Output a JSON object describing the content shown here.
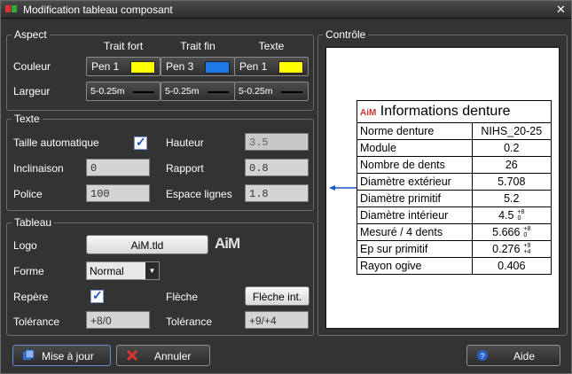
{
  "window": {
    "title": "Modification tableau composant",
    "close": "✕"
  },
  "aspect": {
    "label": "Aspect",
    "headers": [
      "Trait fort",
      "Trait fin",
      "Texte"
    ],
    "couleur_label": "Couleur",
    "largeur_label": "Largeur",
    "pens": [
      {
        "label": "Pen 1",
        "color": "#ffff00"
      },
      {
        "label": "Pen 3",
        "color": "#1e78e6"
      },
      {
        "label": "Pen 1",
        "color": "#ffff00"
      }
    ],
    "widths": [
      "5-0.25m",
      "5-0.25m",
      "5-0.25m"
    ]
  },
  "texte": {
    "label": "Texte",
    "taille_auto_label": "Taille automatique",
    "taille_auto_checked": true,
    "hauteur_label": "Hauteur",
    "hauteur_value": "3.5",
    "inclinaison_label": "Inclinaison",
    "inclinaison_value": "0",
    "rapport_label": "Rapport",
    "rapport_value": "0.8",
    "police_label": "Police",
    "police_value": "100",
    "espace_label": "Espace lignes",
    "espace_value": "1.8"
  },
  "tableau": {
    "label": "Tableau",
    "logo_label": "Logo",
    "logo_button": "AiM.tld",
    "logo_text": "AiM",
    "forme_label": "Forme",
    "forme_value": "Normal",
    "repere_label": "Repère",
    "repere_checked": true,
    "fleche_label": "Flèche",
    "fleche_button": "Flèche int.",
    "tol1_label": "Tolérance",
    "tol1_value": "+8/0",
    "tol2_label": "Tolérance",
    "tol2_value": "+9/+4"
  },
  "controle": {
    "label": "Contrôle",
    "table_logo": "AiM",
    "table_title": "Informations denture",
    "rows": [
      {
        "label": "Norme denture",
        "value": "NIHS_20-25",
        "tol": ""
      },
      {
        "label": "Module",
        "value": "0.2",
        "tol": ""
      },
      {
        "label": "Nombre de dents",
        "value": "26",
        "tol": ""
      },
      {
        "label": "Diamètre extérieur",
        "value": "5.708",
        "tol": ""
      },
      {
        "label": "Diamètre primitif",
        "value": "5.2",
        "tol": ""
      },
      {
        "label": "Diamètre intérieur",
        "value": "4.5",
        "tol": "+8\n0"
      },
      {
        "label": "Mesuré / 4 dents",
        "value": "5.666",
        "tol": "+8\n0"
      },
      {
        "label": "Ep sur primitif",
        "value": "0.276",
        "tol": "+9\n+4"
      },
      {
        "label": "Rayon ogive",
        "value": "0.406",
        "tol": ""
      }
    ]
  },
  "buttons": {
    "update": "Mise à jour",
    "cancel": "Annuler",
    "help": "Aide"
  }
}
